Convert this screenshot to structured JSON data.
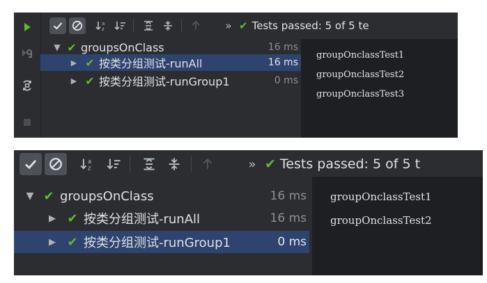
{
  "toolbar": {
    "show_passed_icon": "checkmark-icon",
    "show_ignored_icon": "circle-slash-icon",
    "sort_alpha_icon": "sort-alphabetically-icon",
    "sort_duration_icon": "sort-by-duration-icon",
    "expand_all_icon": "expand-all-icon",
    "collapse_all_icon": "collapse-all-icon",
    "prev_failed_icon": "up-arrow-icon",
    "more": "»",
    "status_text_1": "Tests passed: 5 of 5 te",
    "status_text_2": "Tests passed: 5 of 5 t"
  },
  "gutter": {
    "icons": [
      "run-icon",
      "rerun-failed-icon",
      "toggle-auto-test-icon",
      "stop-icon"
    ]
  },
  "tree": {
    "root": {
      "label": "groupsOnClass",
      "duration": "16 ms"
    },
    "children": [
      {
        "label": "按类分组测试-runAll",
        "duration": "16 ms"
      },
      {
        "label": "按类分组测试-runGroup1",
        "duration": "0 ms"
      }
    ]
  },
  "console1": [
    "groupOnclassTest1",
    "groupOnclassTest2",
    "groupOnclassTest3"
  ],
  "console2": [
    "groupOnclassTest1",
    "groupOnclassTest2"
  ],
  "colors": {
    "panel_bg": "#2b2d30",
    "console_bg": "#1e1f22",
    "selection": "#2e436e",
    "pass_green": "#5fb832",
    "text": "#dfe1e5"
  }
}
